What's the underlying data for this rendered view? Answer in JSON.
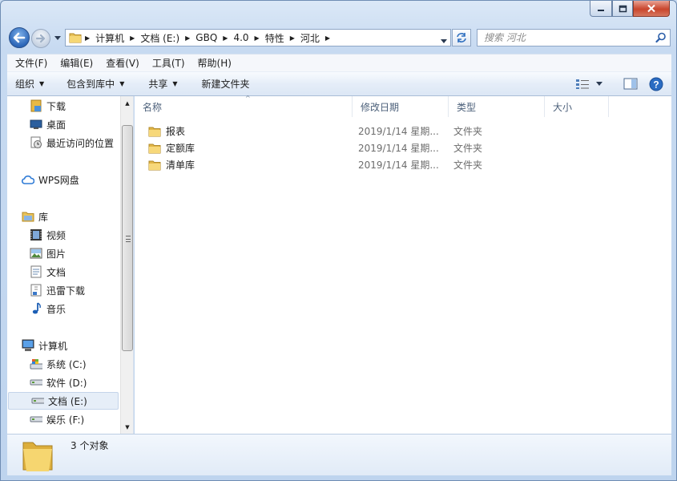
{
  "window": {
    "caption": {
      "minimize": "minimize",
      "maximize": "maximize",
      "close": "close"
    }
  },
  "address": {
    "crumbs": [
      "计算机",
      "文档 (E:)",
      "GBQ",
      "4.0",
      "特性",
      "河北"
    ]
  },
  "search": {
    "placeholder": "搜索 河北"
  },
  "menu": [
    "文件(F)",
    "编辑(E)",
    "查看(V)",
    "工具(T)",
    "帮助(H)"
  ],
  "toolbar": {
    "organize": "组织",
    "include": "包含到库中",
    "share": "共享",
    "newfolder": "新建文件夹"
  },
  "nav": [
    {
      "label": "下载",
      "icon": "downloads-folder-icon",
      "level": 1
    },
    {
      "label": "桌面",
      "icon": "desktop-icon",
      "level": 1
    },
    {
      "label": "最近访问的位置",
      "icon": "recent-places-icon",
      "level": 1
    },
    {
      "label": "WPS网盘",
      "icon": "cloud-icon",
      "level": 0
    },
    {
      "label": "库",
      "icon": "library-icon",
      "level": 0
    },
    {
      "label": "视频",
      "icon": "video-icon",
      "level": 1
    },
    {
      "label": "图片",
      "icon": "pictures-icon",
      "level": 1
    },
    {
      "label": "文档",
      "icon": "documents-icon",
      "level": 1
    },
    {
      "label": "迅雷下载",
      "icon": "thunder-download-icon",
      "level": 1
    },
    {
      "label": "音乐",
      "icon": "music-icon",
      "level": 1
    },
    {
      "label": "计算机",
      "icon": "computer-icon",
      "level": 0
    },
    {
      "label": "系统 (C:)",
      "icon": "system-drive-icon",
      "level": 1
    },
    {
      "label": "软件 (D:)",
      "icon": "drive-icon",
      "level": 1
    },
    {
      "label": "文档 (E:)",
      "icon": "drive-icon",
      "level": 1,
      "selected": true
    },
    {
      "label": "娱乐 (F:)",
      "icon": "drive-icon",
      "level": 1
    }
  ],
  "columns": [
    "名称",
    "修改日期",
    "类型",
    "大小"
  ],
  "files": [
    {
      "name": "报表",
      "date": "2019/1/14 星期...",
      "type": "文件夹",
      "size": ""
    },
    {
      "name": "定额库",
      "date": "2019/1/14 星期...",
      "type": "文件夹",
      "size": ""
    },
    {
      "name": "清单库",
      "date": "2019/1/14 星期...",
      "type": "文件夹",
      "size": ""
    }
  ],
  "status": {
    "text": "3 个对象"
  }
}
